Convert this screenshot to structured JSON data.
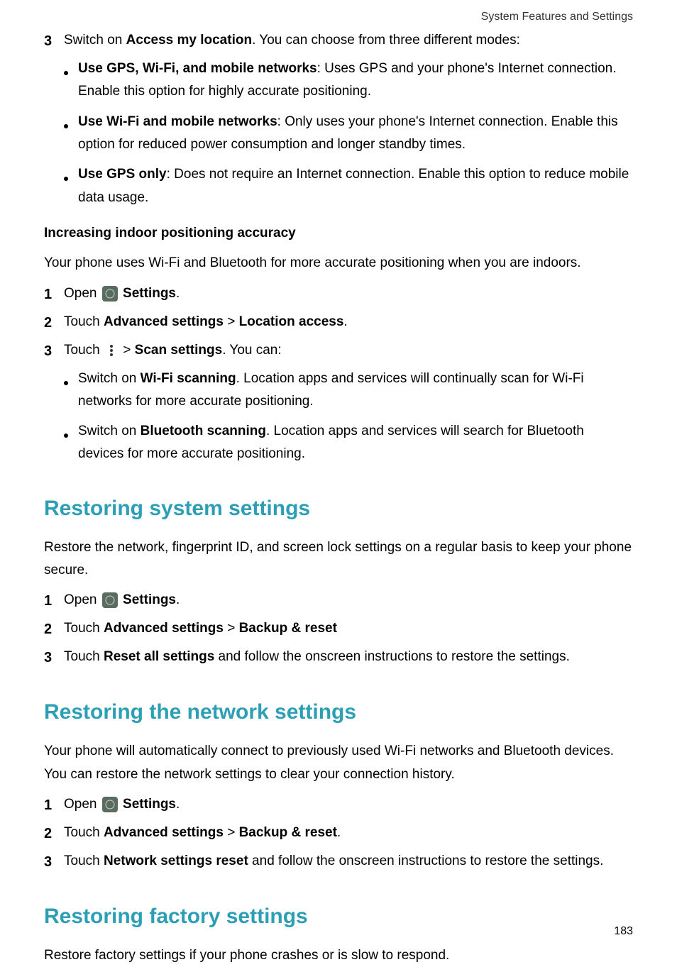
{
  "header": "System Features and Settings",
  "pageNum": "183",
  "section1": {
    "step3": {
      "num": "3",
      "pre": "Switch on ",
      "bold": "Access my location",
      "post": ". You can choose from three different modes:"
    },
    "bullets": [
      {
        "bold": "Use GPS, Wi-Fi, and mobile networks",
        "post": ": Uses GPS and your phone's Internet connection. Enable this option for highly accurate positioning."
      },
      {
        "bold": "Use Wi-Fi and mobile networks",
        "post": ": Only uses your phone's Internet connection. Enable this option for reduced power consumption and longer standby times."
      },
      {
        "bold": "Use GPS only",
        "post": ": Does not require an Internet connection. Enable this option to reduce mobile data usage."
      }
    ]
  },
  "section2": {
    "heading": "Increasing indoor positioning accuracy",
    "intro": "Your phone uses Wi-Fi and Bluetooth for more accurate positioning when you are indoors.",
    "steps": {
      "s1": {
        "num": "1",
        "pre": "Open ",
        "bold": "Settings",
        "post": "."
      },
      "s2": {
        "num": "2",
        "pre": "Touch ",
        "b1": "Advanced settings",
        "sep": " > ",
        "b2": "Location access",
        "post": "."
      },
      "s3": {
        "num": "3",
        "pre": "Touch ",
        "sep": " > ",
        "bold": "Scan settings",
        "post": ". You can:"
      }
    },
    "bullets": [
      {
        "pre": "Switch on ",
        "bold": "Wi-Fi scanning",
        "post": ". Location apps and services will continually scan for Wi-Fi networks for more accurate positioning."
      },
      {
        "pre": "Switch on ",
        "bold": "Bluetooth scanning",
        "post": ". Location apps and services will search for Bluetooth devices for more accurate positioning."
      }
    ]
  },
  "section3": {
    "heading": "Restoring system settings",
    "intro": "Restore the network, fingerprint ID, and screen lock settings on a regular basis to keep your phone secure.",
    "steps": {
      "s1": {
        "num": "1",
        "pre": "Open ",
        "bold": "Settings",
        "post": "."
      },
      "s2": {
        "num": "2",
        "pre": "Touch ",
        "b1": "Advanced settings",
        "sep": " > ",
        "b2": "Backup & reset"
      },
      "s3": {
        "num": "3",
        "pre": "Touch ",
        "bold": "Reset all settings",
        "post": " and follow the onscreen instructions to restore the settings."
      }
    }
  },
  "section4": {
    "heading": "Restoring the network settings",
    "intro": "Your phone will automatically connect to previously used Wi-Fi networks and Bluetooth devices. You can restore the network settings to clear your connection history.",
    "steps": {
      "s1": {
        "num": "1",
        "pre": "Open ",
        "bold": "Settings",
        "post": "."
      },
      "s2": {
        "num": "2",
        "pre": "Touch ",
        "b1": "Advanced settings",
        "sep": " > ",
        "b2": "Backup & reset",
        "post": "."
      },
      "s3": {
        "num": "3",
        "pre": "Touch ",
        "bold": "Network settings reset",
        "post": " and follow the onscreen instructions to restore the settings."
      }
    }
  },
  "section5": {
    "heading": "Restoring factory settings",
    "intro": "Restore factory settings if your phone crashes or is slow to respond."
  }
}
